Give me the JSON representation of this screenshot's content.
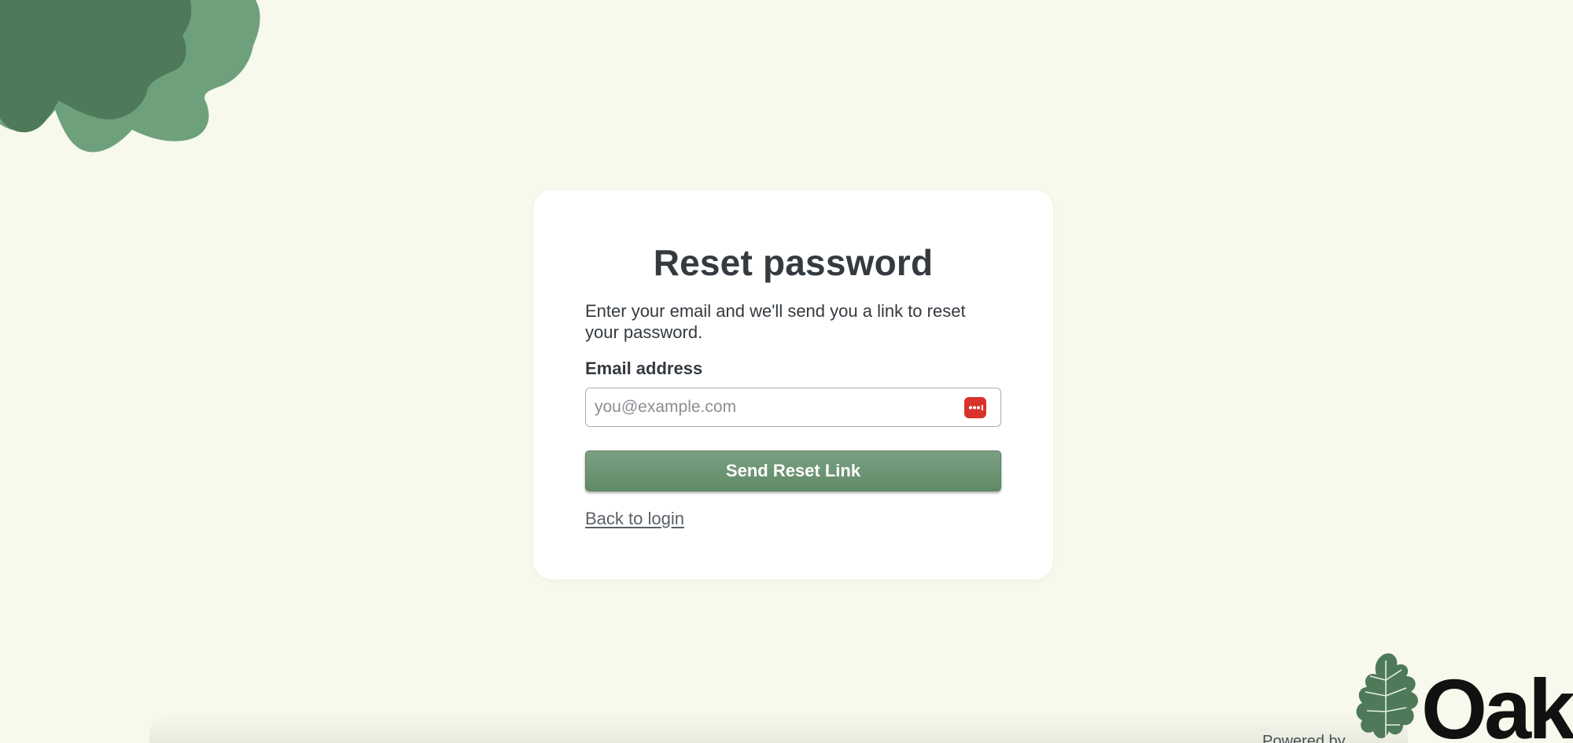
{
  "colors": {
    "background": "#f6f9ec",
    "card": "#ffffff",
    "primary_button": "#6f9575",
    "leaf_dark": "#4e7a59",
    "leaf_light": "#6fa07c",
    "password_manager_icon": "#d8322c"
  },
  "reset_form": {
    "title": "Reset password",
    "description": "Enter your email and we'll send you a link to reset your password.",
    "email_label": "Email address",
    "email_placeholder": "you@example.com",
    "email_value": "",
    "submit_label": "Send Reset Link",
    "back_link_label": "Back to login"
  },
  "password_manager": {
    "icon": "password-dots-icon"
  },
  "branding": {
    "logo_text": "Oak",
    "logo_icon": "oak-leaf-icon",
    "powered_by": "Powered by"
  },
  "decorations": {
    "corner_icon": "leaf-blob-decoration"
  }
}
